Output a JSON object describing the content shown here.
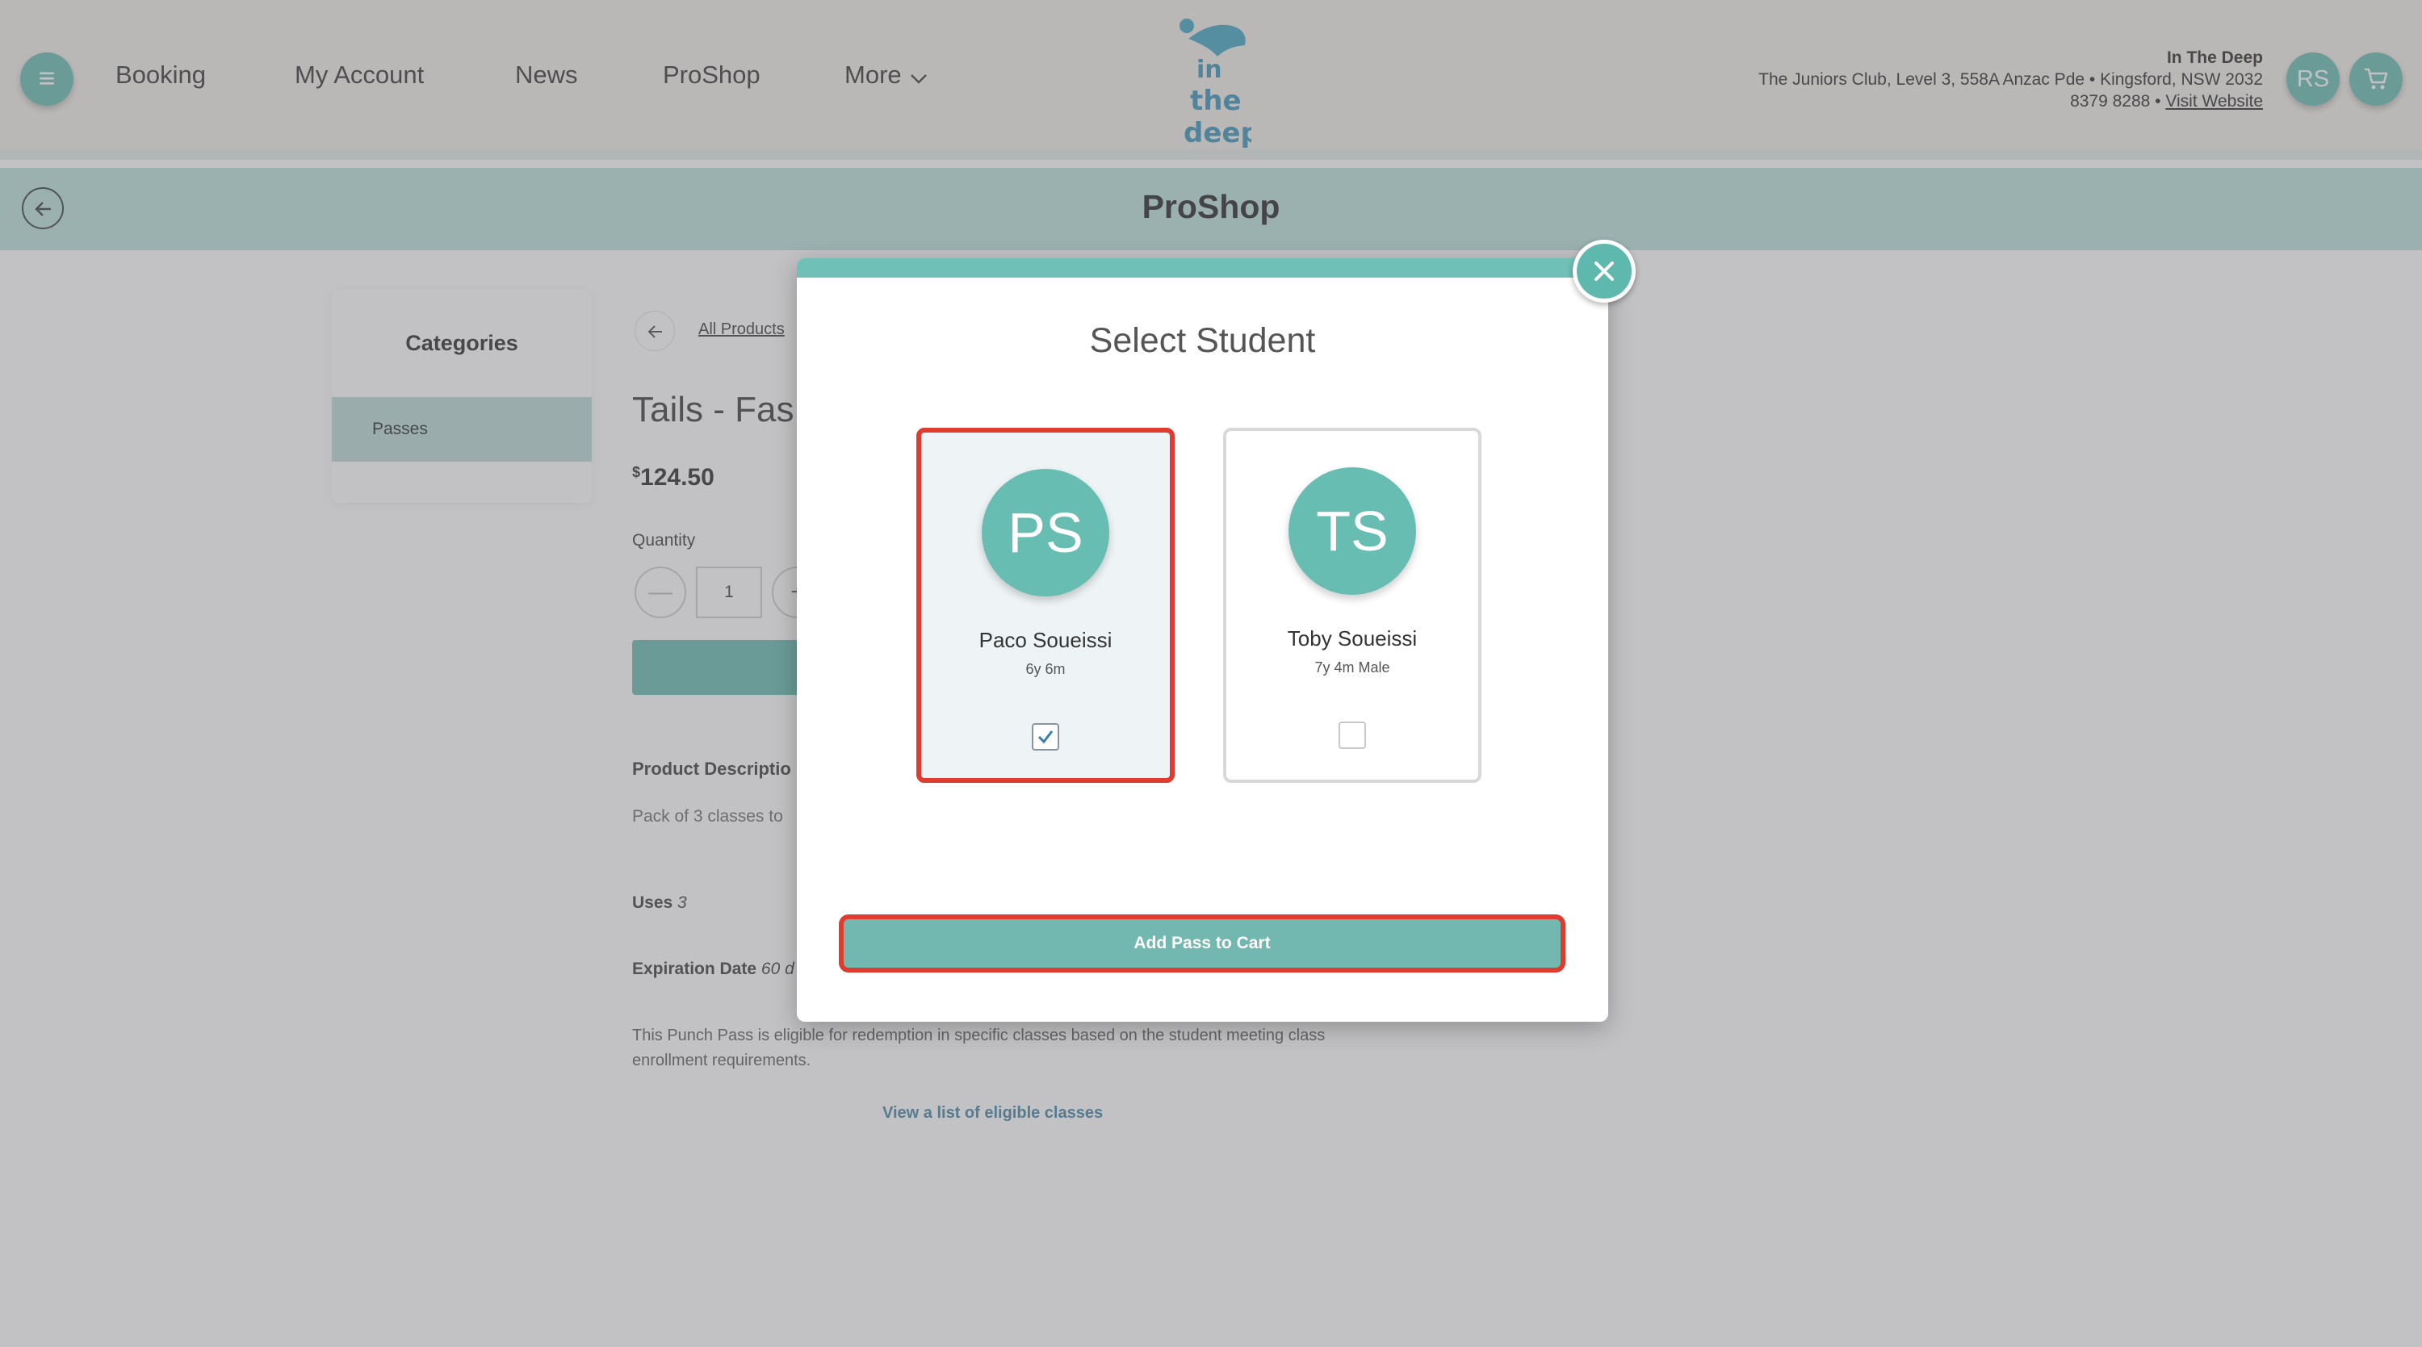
{
  "header": {
    "nav": {
      "booking": "Booking",
      "my_account": "My Account",
      "news": "News",
      "proshop": "ProShop",
      "more": "More"
    },
    "logo_text": "in the deep",
    "business": {
      "name": "In The Deep",
      "address": "The Juniors Club, Level 3, 558A Anzac Pde • Kingsford, NSW 2032",
      "phone": "8379 8288 •",
      "website_link": "Visit Website"
    },
    "avatar_initials": "RS"
  },
  "titlebar": {
    "title": "ProShop"
  },
  "sidebar": {
    "heading": "Categories",
    "items": [
      {
        "label": "Passes"
      }
    ]
  },
  "product": {
    "breadcrumb": "All Products",
    "title": "Tails - Fas",
    "currency": "$",
    "price": "124.50",
    "quantity_label": "Quantity",
    "quantity_value": "1",
    "minus": "—",
    "plus": "+",
    "description_label": "Product Descriptio",
    "description_text": "Pack of 3 classes to",
    "uses_label": "Uses",
    "uses_value": "3",
    "expiry_label": "Expiration Date",
    "expiry_value": "60 d",
    "note": "This Punch Pass is eligible for redemption in specific classes based on the student meeting class enrollment requirements.",
    "eligible_link": "View a list of eligible classes"
  },
  "modal": {
    "title": "Select Student",
    "students": [
      {
        "initials": "PS",
        "name": "Paco Soueissi",
        "detail": "6y 6m",
        "checked": true
      },
      {
        "initials": "TS",
        "name": "Toby Soueissi",
        "detail": "7y 4m Male",
        "checked": false
      }
    ],
    "add_button": "Add Pass to Cart"
  },
  "colors": {
    "brand_teal": "#5fb8ae",
    "header_bg": "#f1ede7",
    "titlebar_bg": "#b7e0db",
    "highlight_red": "#e03b2f"
  },
  "icons": {
    "menu": "hamburger-icon",
    "cart": "cart-icon",
    "back": "arrow-left-icon",
    "more": "chevron-down-icon",
    "close": "close-icon",
    "check": "checkmark-icon"
  }
}
